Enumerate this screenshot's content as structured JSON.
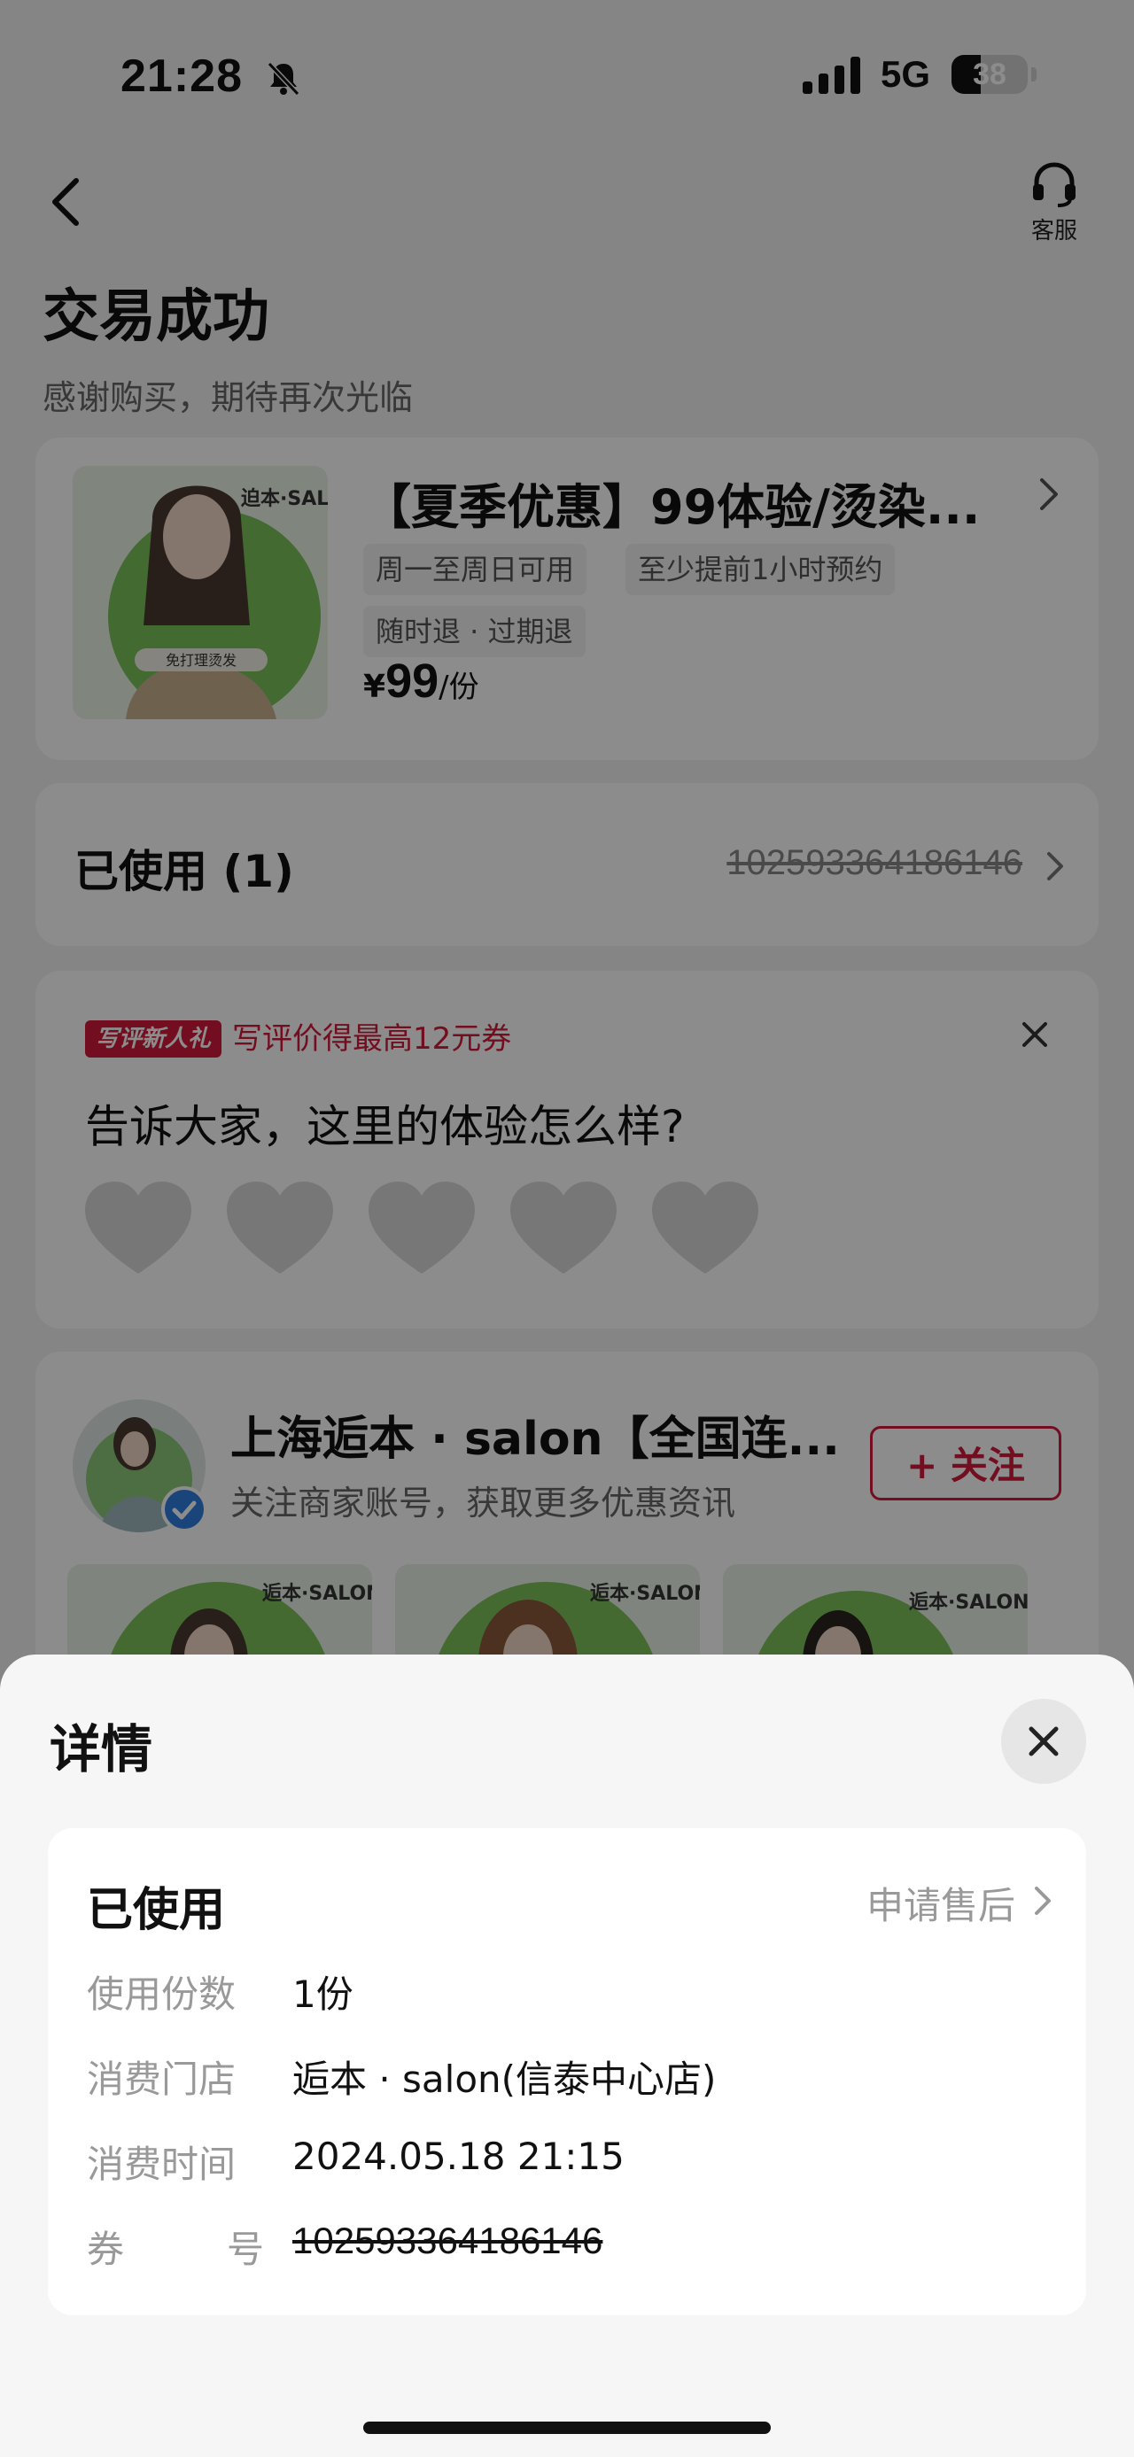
{
  "status_bar": {
    "time": "21:28",
    "network": "5G",
    "battery": "38",
    "battery_level": 0.38
  },
  "nav": {
    "service_label": "客服"
  },
  "header": {
    "title": "交易成功",
    "subtitle": "感谢购买，期待再次光临"
  },
  "product": {
    "title": "【夏季优惠】99体验/烫染...",
    "tags": [
      "周一至周日可用",
      "至少提前1小时预约",
      "随时退 · 过期退"
    ],
    "price_symbol": "¥",
    "price": "99",
    "price_unit": "/份",
    "thumb_text_1": "迫本·SAL",
    "thumb_text_2": "免打理烫发"
  },
  "usage": {
    "label": "已使用 (1)",
    "code": "102593364186146"
  },
  "review": {
    "badge": "写评新人礼",
    "promo": "写评价得最高12元券",
    "question": "告诉大家，这里的体验怎么样?"
  },
  "merchant": {
    "name": "上海逅本 · salon【全国连...",
    "desc": "关注商家账号，获取更多优惠资讯",
    "follow_label": "+ 关注",
    "photo_label": "逅本·SALON"
  },
  "sheet": {
    "title": "详情",
    "status": "已使用",
    "after_sale": "申请售后",
    "rows": [
      {
        "label": "使用份数",
        "value": "1份"
      },
      {
        "label": "消费门店",
        "value": "逅本 · salon(信泰中心店)"
      },
      {
        "label": "消费时间",
        "value": "2024.05.18 21:15"
      },
      {
        "label_a": "券",
        "label_b": "号",
        "value": "102593364186146"
      }
    ]
  },
  "colors": {
    "accent_red": "#d21b3c",
    "overlay": "rgba(0,0,0,0.45)"
  }
}
